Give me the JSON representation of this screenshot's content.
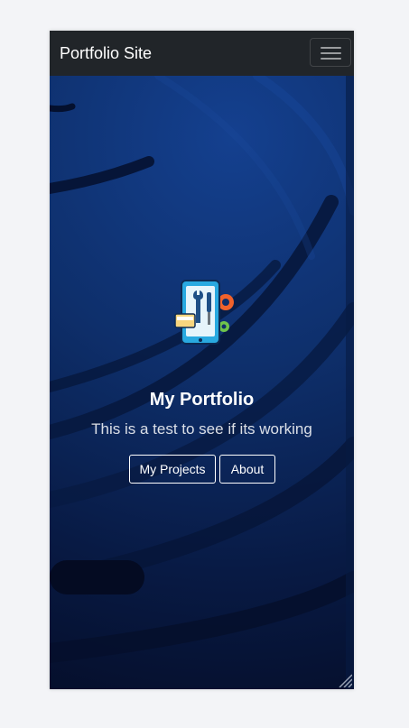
{
  "navbar": {
    "brand": "Portfolio Site",
    "toggle_icon": "hamburger-menu-icon"
  },
  "hero": {
    "logo_icon": "phone-tools-gears-icon",
    "title": "My Portfolio",
    "subtitle": "This is a test to see if its working",
    "buttons": [
      {
        "label": "My Projects"
      },
      {
        "label": "About"
      }
    ]
  },
  "colors": {
    "navbar_bg": "#212529",
    "hero_bg": "#0e2f6b",
    "text": "#ffffff",
    "page_bg": "#f3f4f7"
  }
}
